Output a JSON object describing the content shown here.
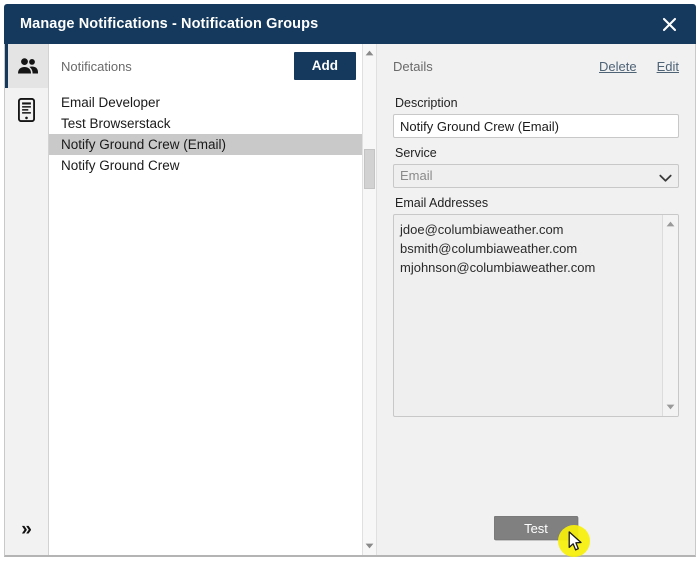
{
  "window": {
    "title": "Manage Notifications - Notification Groups",
    "close_label": "✕",
    "titlebar_color": "#14395c"
  },
  "rail": {
    "items": [
      {
        "icon": "users-group-icon",
        "active": true
      },
      {
        "icon": "mobile-device-icon",
        "active": false
      }
    ],
    "expand_label": "»"
  },
  "list_panel": {
    "header_label": "Notifications",
    "add_label": "Add",
    "items": [
      {
        "label": "Email Developer",
        "selected": false
      },
      {
        "label": "Test Browserstack",
        "selected": false
      },
      {
        "label": "Notify Ground Crew (Email)",
        "selected": true
      },
      {
        "label": "Notify Ground Crew",
        "selected": false
      }
    ]
  },
  "details_panel": {
    "title": "Details",
    "delete_label": "Delete",
    "edit_label": "Edit",
    "description_label": "Description",
    "description_value": "Notify Ground Crew (Email)",
    "description_placeholder": "Description",
    "service_label": "Service",
    "service_value": "Email",
    "service_options": [
      "Email"
    ],
    "emails_label": "Email Addresses",
    "emails": [
      "jdoe@columbiaweather.com",
      "bsmith@columbiaweather.com",
      "mjohnson@columbiaweather.com"
    ],
    "test_label": "Test"
  },
  "colors": {
    "accent": "#14395c",
    "panel_bg": "#f1f1f1",
    "selection": "#c9c9c9",
    "link": "#4e6376",
    "test_button": "#808080",
    "cursor_highlight": "#f7f008"
  }
}
